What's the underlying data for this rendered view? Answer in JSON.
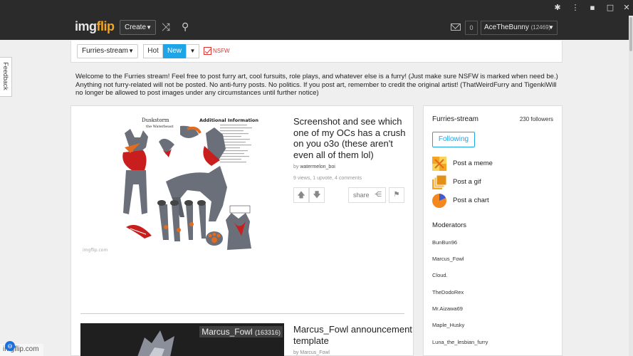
{
  "browser": {
    "controls": [
      "puzzle-icon",
      "more-vert-icon",
      "minimize-icon",
      "maximize-icon",
      "close-icon"
    ]
  },
  "header": {
    "logo_part1": "img",
    "logo_part2": "flip",
    "create_label": "Create",
    "notif_count": "0",
    "username": "AceTheBunny",
    "user_points": "(12469)"
  },
  "stream_bar": {
    "stream_name": "Furries-stream",
    "sort_hot": "Hot",
    "sort_new": "New",
    "nsfw_label": "NSFW",
    "active_sort_color": "#1ea5e8"
  },
  "description": "Welcome to the Furries stream! Feel free to post furry art, cool fursuits, role plays, and whatever else is a furry! (Just make sure NSFW is marked when need be.) Anything not furry-related will not be posted. No anti-furry posts. No politics. If you post art, remember to credit the original artist! (ThatWeirdFurry and TigenkiWill no longer be allowed to post images under any circumstances until further notice)",
  "feedback_label": "Feedback",
  "posts": [
    {
      "title": "Screenshot and see which one of my OCs has a crush on you o3o (these aren't even all of them lol)",
      "by_prefix": "by",
      "author": "watermelon_boi",
      "stats": "9 views, 1 upvote, 4 comments",
      "share_label": "share",
      "image_text_1": "Duskstorm",
      "image_text_2": "the Waterbeast",
      "image_text_3": "Additional Information",
      "image_watermark": "imgflip.com"
    },
    {
      "title": "Marcus_Fowl announcement template",
      "by_prefix": "by",
      "author": "Marcus_Fowl",
      "image_name": "Marcus_Fowl",
      "image_points": "(163316)"
    }
  ],
  "sidebar": {
    "stream_name": "Furries-stream",
    "followers": "230 followers",
    "following_label": "Following",
    "post_links": [
      {
        "label": "Post a meme",
        "icon": "meme-icon"
      },
      {
        "label": "Post a gif",
        "icon": "gif-icon"
      },
      {
        "label": "Post a chart",
        "icon": "chart-icon"
      }
    ],
    "moderators_title": "Moderators",
    "moderators": [
      "BunBun96",
      "Marcus_Fowl",
      "Cloud.",
      "TheDodoRex",
      "Mr.Aizawa69",
      "Maple_Husky",
      "Luna_the_lesbian_furry"
    ]
  },
  "status": {
    "url": "imgflip.com"
  }
}
